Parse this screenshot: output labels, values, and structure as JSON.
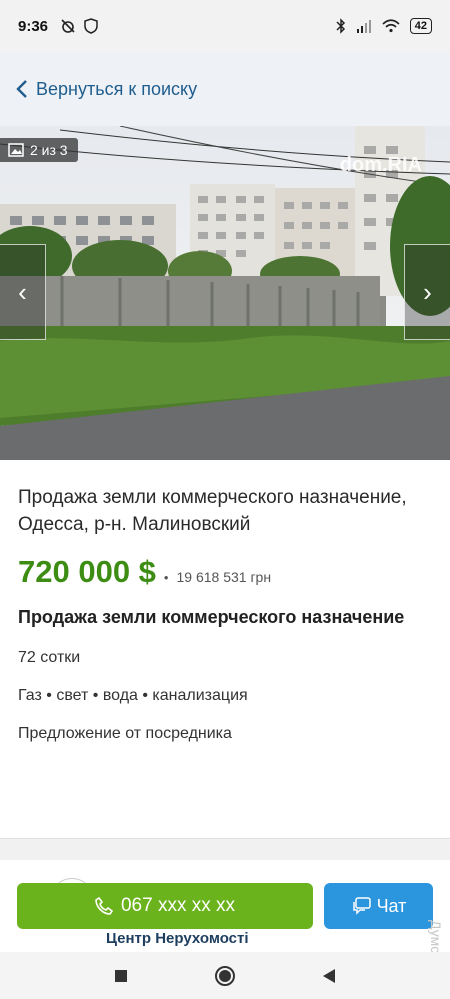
{
  "status": {
    "time": "9:36",
    "battery": "42"
  },
  "topbar": {
    "back_label": "Вернуться к поиску"
  },
  "gallery": {
    "counter": "2 из 3",
    "watermark": "dom.RIA",
    "prev_glyph": "‹",
    "next_glyph": "›"
  },
  "listing": {
    "title": "Продажа земли коммерческого назначение, Одесса, р-н. Малиновский",
    "price": "720 000 $",
    "price_sep": "•",
    "price_uah": "19 618 531 грн",
    "subtitle": "Продажа земли коммерческого назначение",
    "area": "72 сотки",
    "utilities": "Газ • свет • вода • канализация",
    "offer": "Предложение от посредника"
  },
  "seller": {
    "name": "Центр Нерухомості"
  },
  "actions": {
    "call_label": "067 xxx xx xx",
    "chat_label": "Чат"
  },
  "side_watermark": "Думская",
  "colors": {
    "price": "#3d8d15",
    "call_button": "#6bb31d",
    "chat_button": "#2b95dd",
    "link": "#1f5d8e"
  }
}
